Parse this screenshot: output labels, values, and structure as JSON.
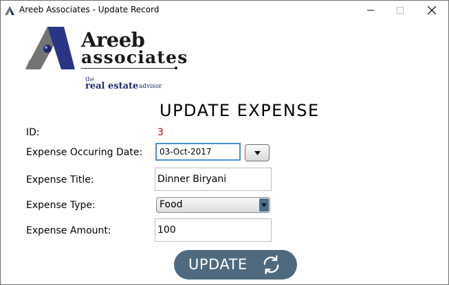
{
  "window": {
    "title": "Areeb Associates - Update Record",
    "app_icon": "triangle-logo-icon",
    "controls": [
      "minimize-icon",
      "maximize-icon",
      "close-icon"
    ]
  },
  "logo": {
    "name_line1": "Areeb",
    "name_line2": "associates",
    "tagline_the": "the",
    "tagline_main": "real estate",
    "tagline_advisor": "advisor"
  },
  "heading": "UPDATE EXPENSE",
  "form": {
    "id_label": "ID:",
    "id_value": "3",
    "date_label": "Expense Occuring Date:",
    "date_value": "03-Oct-2017",
    "title_label": "Expense Title:",
    "title_value": "Dinner Biryani",
    "type_label": "Expense Type:",
    "type_value": "Food",
    "amount_label": "Expense Amount:",
    "amount_value": "100"
  },
  "actions": {
    "update_label": "UPDATE",
    "update_icon": "refresh-icon"
  },
  "colors": {
    "id_value": "#c00000",
    "update_button": "#4f6a7e",
    "focus_border": "#4a90d9"
  }
}
